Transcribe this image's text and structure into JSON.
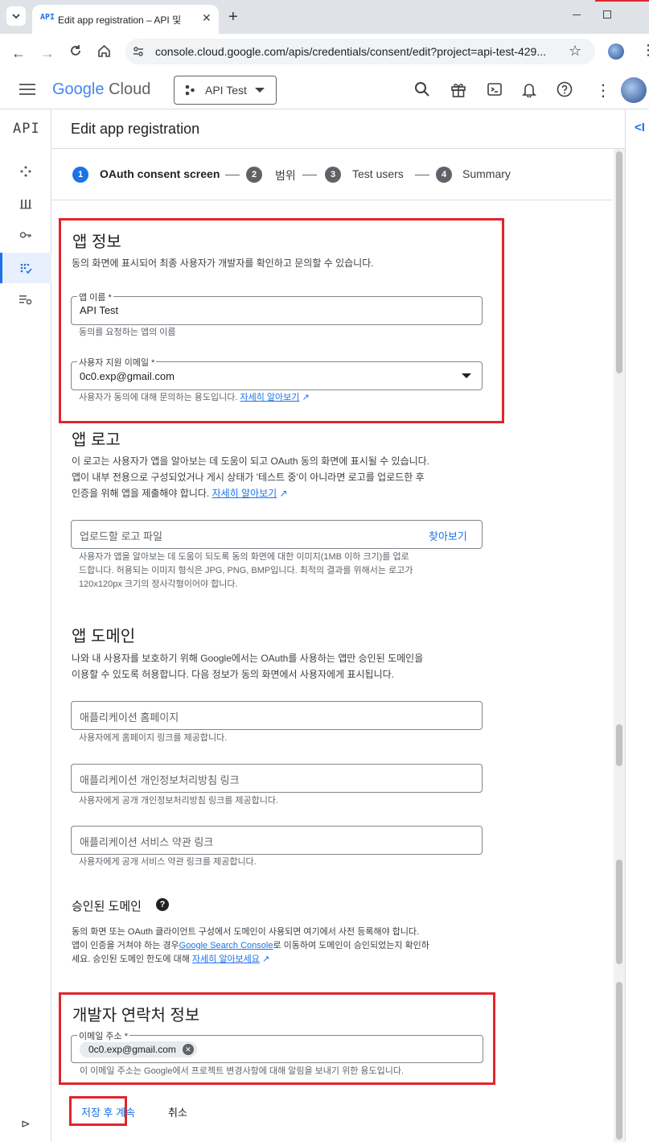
{
  "browser": {
    "tab_title": "Edit app registration – API 및",
    "tab_favicon_text": "API",
    "url": "console.cloud.google.com/apis/credentials/consent/edit?project=api-test-429..."
  },
  "cloud_header": {
    "logo_google": "Google",
    "logo_cloud": "Cloud",
    "project_name": "API Test"
  },
  "rail": {
    "api_label": "API"
  },
  "page": {
    "title": "Edit app registration",
    "steps": [
      {
        "num": "1",
        "label": "OAuth consent screen"
      },
      {
        "num": "2",
        "label": "범위"
      },
      {
        "num": "3",
        "label": "Test users"
      },
      {
        "num": "4",
        "label": "Summary"
      }
    ]
  },
  "app_info": {
    "heading": "앱 정보",
    "desc": "동의 화면에 표시되어 최종 사용자가 개발자를 확인하고 문의할 수 있습니다.",
    "app_name_label": "앱 이름 *",
    "app_name_value": "API Test",
    "app_name_hint": "동의를 요청하는 앱의 이름",
    "email_label": "사용자 지원 이메일 *",
    "email_value": "0c0.exp@gmail.com",
    "email_hint": "사용자가 동의에 대해 문의하는 용도입니다.",
    "email_hint_link": "자세히 알아보기"
  },
  "app_logo": {
    "heading": "앱 로고",
    "desc_line1": "이 로고는 사용자가 앱을 알아보는 데 도움이 되고 OAuth 동의 화면에 표시될 수 있습니다.",
    "desc_line2": "앱이 내부 전용으로 구성되었거나 게시 상태가 '테스트 중'이 아니라면 로고를 업로드한 후",
    "desc_line3": "인증을 위해 앱을 제출해야 합니다.",
    "desc_link": "자세히 알아보기",
    "upload_placeholder": "업로드할 로고 파일",
    "browse_label": "찾아보기",
    "hint_line1": "사용자가 앱을 알아보는 데 도움이 되도록 동의 화면에 대한 이미지(1MB 이하 크기)를 업로",
    "hint_line2": "드합니다. 허용되는 이미지 형식은 JPG, PNG, BMP입니다. 최적의 결과를 위해서는 로고가",
    "hint_line3": "120x120px 크기의 정사각형이어야 합니다."
  },
  "app_domain": {
    "heading": "앱 도메인",
    "desc_line1": "나와 내 사용자를 보호하기 위해 Google에서는 OAuth를 사용하는 앱만 승인된 도메인을",
    "desc_line2": "이용할 수 있도록 허용합니다. 다음 정보가 동의 화면에서 사용자에게 표시됩니다.",
    "homepage_placeholder": "애플리케이션 홈페이지",
    "homepage_hint": "사용자에게 홈페이지 링크를 제공합니다.",
    "privacy_placeholder": "애플리케이션 개인정보처리방침 링크",
    "privacy_hint": "사용자에게 공개 개인정보처리방침 링크를 제공합니다.",
    "tos_placeholder": "애플리케이션 서비스 약관 링크",
    "tos_hint": "사용자에게 공개 서비스 약관 링크를 제공합니다."
  },
  "authorized_domains": {
    "heading": "승인된 도메인",
    "desc_line1": "동의 화면 또는 OAuth 클라이언트 구성에서 도메인이 사용되면 여기에서 사전 등록해야 합니다.",
    "desc_line2a": "앱이 인증을 거쳐야 하는 경우",
    "desc_line2_link": "Google Search Console",
    "desc_line2b": "로 이동하여 도메인이 승인되었는지 확인하",
    "desc_line3a": "세요. 승인된 도메인 한도에 대해",
    "desc_line3_link": "자세히 알아보세요"
  },
  "developer_contact": {
    "heading": "개발자 연락처 정보",
    "email_label": "이메일 주소 *",
    "email_chip": "0c0.exp@gmail.com",
    "hint": "이 이메일 주소는 Google에서 프로젝트 변경사항에 대해 알림을 보내기 위한 용도입니다."
  },
  "actions": {
    "save_continue": "저장 후 계속",
    "cancel": "취소"
  },
  "colors": {
    "accent": "#1a73e8",
    "highlight_red": "#e0262c",
    "step_active": "#1a73e8",
    "step_inactive": "#5f6368"
  }
}
